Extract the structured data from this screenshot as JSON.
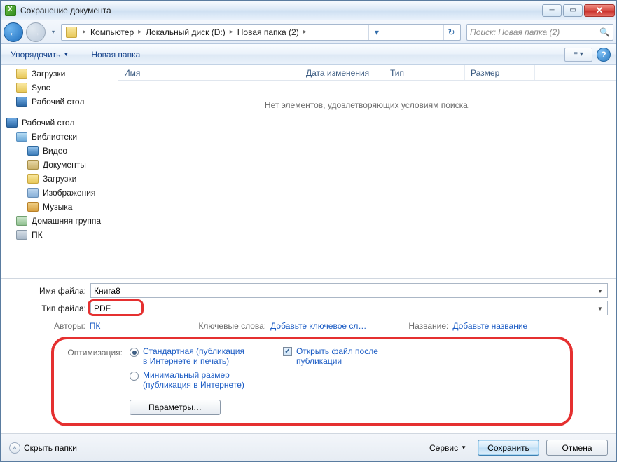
{
  "title": "Сохранение документа",
  "breadcrumb": {
    "root_icon": "computer",
    "segments": [
      "Компьютер",
      "Локальный диск (D:)",
      "Новая папка (2)"
    ]
  },
  "search_placeholder": "Поиск: Новая папка (2)",
  "toolbar": {
    "organize": "Упорядочить",
    "new_folder": "Новая папка"
  },
  "tree": {
    "items": [
      {
        "label": "Загрузки",
        "icon": "t-folder",
        "depth": 1
      },
      {
        "label": "Sync",
        "icon": "t-folder",
        "depth": 1
      },
      {
        "label": "Рабочий стол",
        "icon": "t-desk",
        "depth": 1
      },
      {
        "label": "",
        "icon": "",
        "depth": 0,
        "spacer": true
      },
      {
        "label": "Рабочий стол",
        "icon": "t-desk",
        "depth": 0
      },
      {
        "label": "Библиотеки",
        "icon": "t-lib",
        "depth": 1
      },
      {
        "label": "Видео",
        "icon": "t-vid",
        "depth": 2
      },
      {
        "label": "Документы",
        "icon": "t-doc",
        "depth": 2
      },
      {
        "label": "Загрузки",
        "icon": "t-folder",
        "depth": 2
      },
      {
        "label": "Изображения",
        "icon": "t-img",
        "depth": 2
      },
      {
        "label": "Музыка",
        "icon": "t-mus",
        "depth": 2
      },
      {
        "label": "Домашняя группа",
        "icon": "t-grp",
        "depth": 1
      },
      {
        "label": "ПК",
        "icon": "t-pc",
        "depth": 1
      }
    ]
  },
  "columns": {
    "name": "Имя",
    "date": "Дата изменения",
    "type": "Тип",
    "size": "Размер"
  },
  "empty_message": "Нет элементов, удовлетворяющих условиям поиска.",
  "form": {
    "filename_label": "Имя файла:",
    "filename_value": "Книга8",
    "filetype_label": "Тип файла:",
    "filetype_value": "PDF"
  },
  "meta": {
    "authors_label": "Авторы:",
    "authors_value": "ПК",
    "keywords_label": "Ключевые слова:",
    "keywords_value": "Добавьте ключевое сл…",
    "title_label": "Название:",
    "title_value": "Добавьте название"
  },
  "options": {
    "label": "Оптимизация:",
    "radio1": "Стандартная (публикация в Интернете и печать)",
    "radio2": "Минимальный размер (публикация в Интернете)",
    "checkbox": "Открыть файл после публикации",
    "params_btn": "Параметры…"
  },
  "footer": {
    "hide_folders": "Скрыть папки",
    "service": "Сервис",
    "save": "Сохранить",
    "cancel": "Отмена"
  }
}
